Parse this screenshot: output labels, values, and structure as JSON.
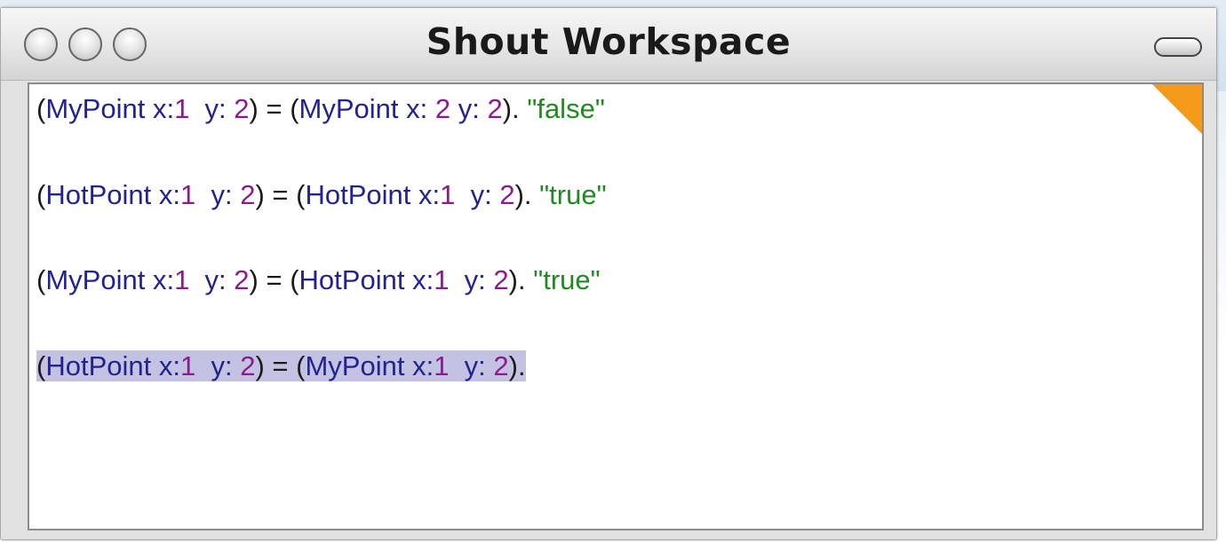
{
  "window": {
    "title": "Shout Workspace"
  },
  "editor": {
    "lines": [
      {
        "tokens": [
          {
            "t": "(",
            "k": "op"
          },
          {
            "t": "MyPoint",
            "k": "id"
          },
          {
            "t": " ",
            "k": "op"
          },
          {
            "t": "x:",
            "k": "id"
          },
          {
            "t": "1",
            "k": "num"
          },
          {
            "t": "  ",
            "k": "op"
          },
          {
            "t": "y:",
            "k": "id"
          },
          {
            "t": " ",
            "k": "op"
          },
          {
            "t": "2",
            "k": "num"
          },
          {
            "t": ") = (",
            "k": "op"
          },
          {
            "t": "MyPoint",
            "k": "id"
          },
          {
            "t": " ",
            "k": "op"
          },
          {
            "t": "x:",
            "k": "id"
          },
          {
            "t": " ",
            "k": "op"
          },
          {
            "t": "2",
            "k": "num"
          },
          {
            "t": " ",
            "k": "op"
          },
          {
            "t": "y:",
            "k": "id"
          },
          {
            "t": " ",
            "k": "op"
          },
          {
            "t": "2",
            "k": "num"
          },
          {
            "t": "). ",
            "k": "op"
          },
          {
            "t": "\"false\"",
            "k": "str"
          }
        ]
      },
      {
        "tokens": [
          {
            "t": "(",
            "k": "op"
          },
          {
            "t": "HotPoint",
            "k": "id"
          },
          {
            "t": " ",
            "k": "op"
          },
          {
            "t": "x:",
            "k": "id"
          },
          {
            "t": "1",
            "k": "num"
          },
          {
            "t": "  ",
            "k": "op"
          },
          {
            "t": "y:",
            "k": "id"
          },
          {
            "t": " ",
            "k": "op"
          },
          {
            "t": "2",
            "k": "num"
          },
          {
            "t": ") = (",
            "k": "op"
          },
          {
            "t": "HotPoint",
            "k": "id"
          },
          {
            "t": " ",
            "k": "op"
          },
          {
            "t": "x:",
            "k": "id"
          },
          {
            "t": "1",
            "k": "num"
          },
          {
            "t": "  ",
            "k": "op"
          },
          {
            "t": "y:",
            "k": "id"
          },
          {
            "t": " ",
            "k": "op"
          },
          {
            "t": "2",
            "k": "num"
          },
          {
            "t": "). ",
            "k": "op"
          },
          {
            "t": "\"true\"",
            "k": "str"
          }
        ]
      },
      {
        "tokens": [
          {
            "t": "(",
            "k": "op"
          },
          {
            "t": "MyPoint",
            "k": "id"
          },
          {
            "t": " ",
            "k": "op"
          },
          {
            "t": "x:",
            "k": "id"
          },
          {
            "t": "1",
            "k": "num"
          },
          {
            "t": "  ",
            "k": "op"
          },
          {
            "t": "y:",
            "k": "id"
          },
          {
            "t": " ",
            "k": "op"
          },
          {
            "t": "2",
            "k": "num"
          },
          {
            "t": ") = (",
            "k": "op"
          },
          {
            "t": "HotPoint",
            "k": "id"
          },
          {
            "t": " ",
            "k": "op"
          },
          {
            "t": "x:",
            "k": "id"
          },
          {
            "t": "1",
            "k": "num"
          },
          {
            "t": "  ",
            "k": "op"
          },
          {
            "t": "y:",
            "k": "id"
          },
          {
            "t": " ",
            "k": "op"
          },
          {
            "t": "2",
            "k": "num"
          },
          {
            "t": "). ",
            "k": "op"
          },
          {
            "t": "\"true\"",
            "k": "str"
          }
        ]
      },
      {
        "selected": true,
        "tokens": [
          {
            "t": "(",
            "k": "op"
          },
          {
            "t": "HotPoint",
            "k": "id"
          },
          {
            "t": " ",
            "k": "op"
          },
          {
            "t": "x:",
            "k": "id"
          },
          {
            "t": "1",
            "k": "num"
          },
          {
            "t": "  ",
            "k": "op"
          },
          {
            "t": "y:",
            "k": "id"
          },
          {
            "t": " ",
            "k": "op"
          },
          {
            "t": "2",
            "k": "num"
          },
          {
            "t": ") = (",
            "k": "op"
          },
          {
            "t": "MyPoint",
            "k": "id"
          },
          {
            "t": " ",
            "k": "op"
          },
          {
            "t": "x:",
            "k": "id"
          },
          {
            "t": "1",
            "k": "num"
          },
          {
            "t": "  ",
            "k": "op"
          },
          {
            "t": "y:",
            "k": "id"
          },
          {
            "t": " ",
            "k": "op"
          },
          {
            "t": "2",
            "k": "num"
          },
          {
            "t": ").",
            "k": "op"
          }
        ]
      }
    ]
  },
  "colors": {
    "identifier": "#23238e",
    "number": "#8a1b8a",
    "string": "#208a20",
    "selection": "#c3c2e2",
    "corner_flag": "#f39a1b"
  },
  "icons": {
    "close": "window-close-icon",
    "minimize": "window-minimize-icon",
    "zoom": "window-zoom-icon",
    "collapse": "window-collapse-icon"
  }
}
